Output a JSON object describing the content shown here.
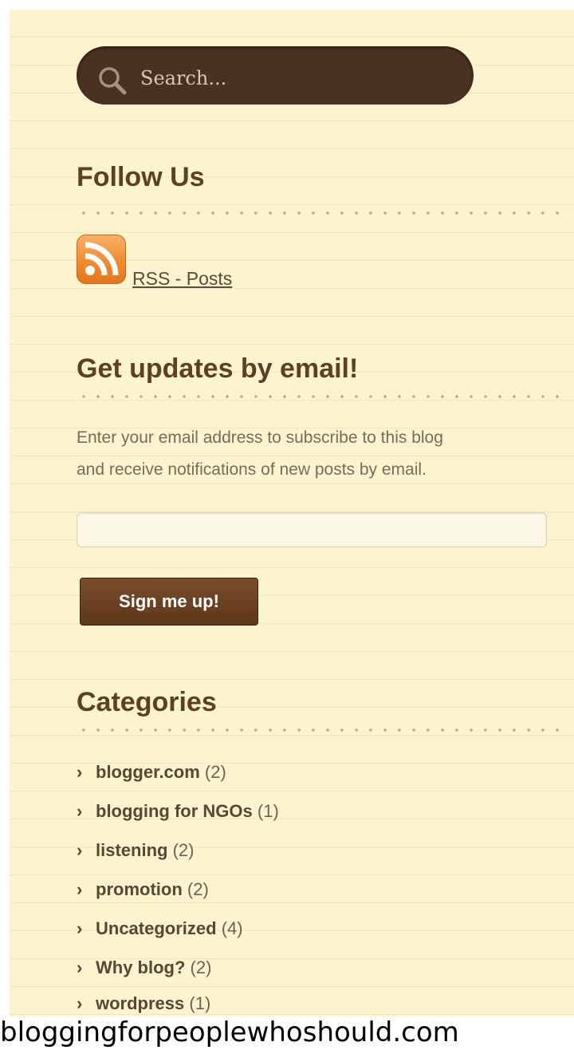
{
  "search": {
    "placeholder": "Search..."
  },
  "follow": {
    "title": "Follow Us",
    "rss_label": "RSS - Posts",
    "rss_icon": "rss-feed-icon"
  },
  "email_updates": {
    "title": "Get updates by email!",
    "description_line1": "Enter your email address to subscribe to this blog",
    "description_line2": "and receive notifications of new posts by email.",
    "email_value": "",
    "button_label": "Sign me up!"
  },
  "categories": {
    "title": "Categories",
    "items": [
      {
        "name": "blogger.com",
        "count": "(2)"
      },
      {
        "name": "blogging for NGOs",
        "count": "(1)"
      },
      {
        "name": "listening",
        "count": "(2)"
      },
      {
        "name": "promotion",
        "count": "(2)"
      },
      {
        "name": "Uncategorized",
        "count": "(4)"
      },
      {
        "name": "Why blog?",
        "count": "(2)"
      },
      {
        "name": "wordpress",
        "count": "(1)"
      }
    ]
  },
  "caption": "bloggingforpeoplewhoshould.com",
  "colors": {
    "background": "#fbf4cf",
    "heading": "#5f3f21",
    "search_bar": "#4a3222",
    "button": "#6a4224",
    "rss_orange": "#f28b2c"
  }
}
